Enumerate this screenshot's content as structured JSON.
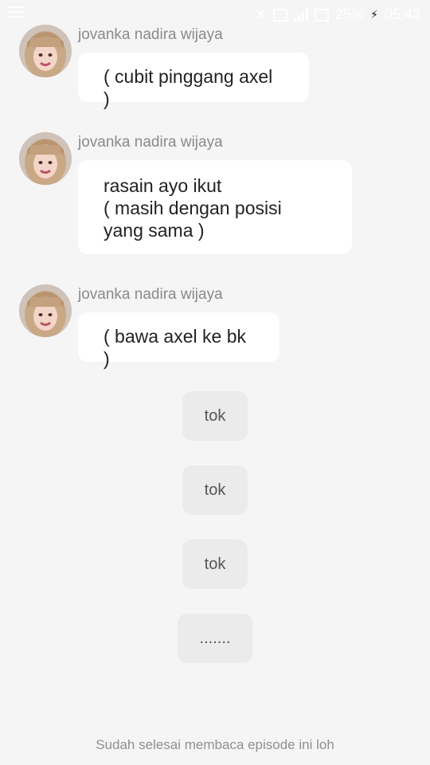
{
  "status_bar": {
    "battery": "25%",
    "time": "05:43"
  },
  "messages": [
    {
      "sender": "jovanka nadira  wijaya",
      "text": "( cubit pinggang axel )"
    },
    {
      "sender": "jovanka nadira  wijaya",
      "text": "rasain ayo ikut\n( masih dengan posisi\nyang sama )"
    },
    {
      "sender": "jovanka nadira  wijaya",
      "text": "( bawa axel ke bk )"
    }
  ],
  "narration": [
    {
      "text": "tok"
    },
    {
      "text": "tok"
    },
    {
      "text": "tok"
    },
    {
      "text": "......."
    }
  ],
  "footer": {
    "note": "Sudah selesai membaca episode ini loh"
  }
}
